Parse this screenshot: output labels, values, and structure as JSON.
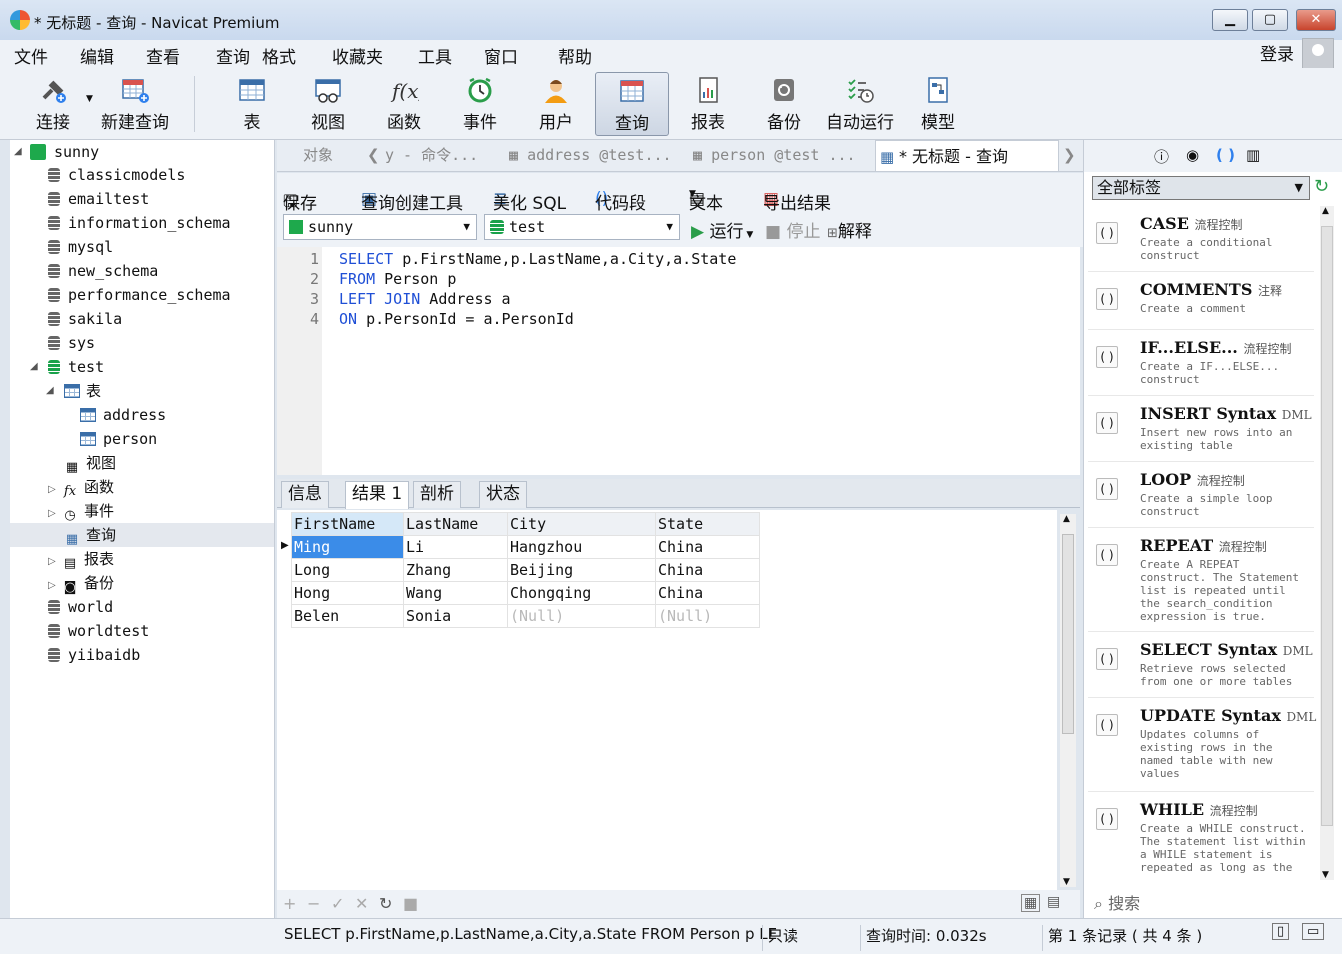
{
  "window": {
    "title": "* 无标题 - 查询 - Navicat Premium"
  },
  "menu": [
    "文件",
    "编辑",
    "查看",
    "查询",
    "格式",
    "收藏夹",
    "工具",
    "窗口",
    "帮助"
  ],
  "account": {
    "login": "登录"
  },
  "toolbar": [
    "连接",
    "新建查询",
    "表",
    "视图",
    "函数",
    "事件",
    "用户",
    "查询",
    "报表",
    "备份",
    "自动运行",
    "模型"
  ],
  "tree": [
    {
      "label": "sunny",
      "kind": "connection"
    },
    {
      "label": "classicmodels",
      "kind": "db"
    },
    {
      "label": "emailtest",
      "kind": "db"
    },
    {
      "label": "information_schema",
      "kind": "db"
    },
    {
      "label": "mysql",
      "kind": "db"
    },
    {
      "label": "new_schema",
      "kind": "db"
    },
    {
      "label": "performance_schema",
      "kind": "db"
    },
    {
      "label": "sakila",
      "kind": "db"
    },
    {
      "label": "sys",
      "kind": "db"
    },
    {
      "label": "test",
      "kind": "db-open"
    },
    {
      "label": "表",
      "kind": "folder"
    },
    {
      "label": "address",
      "kind": "table"
    },
    {
      "label": "person",
      "kind": "table"
    },
    {
      "label": "视图",
      "kind": "folder"
    },
    {
      "label": "函数",
      "kind": "folder"
    },
    {
      "label": "事件",
      "kind": "folder"
    },
    {
      "label": "查询",
      "kind": "folder"
    },
    {
      "label": "报表",
      "kind": "folder"
    },
    {
      "label": "备份",
      "kind": "folder"
    },
    {
      "label": "world",
      "kind": "db"
    },
    {
      "label": "worldtest",
      "kind": "db"
    },
    {
      "label": "yiibaidb",
      "kind": "db"
    }
  ],
  "tabs": [
    "对象",
    "y - 命令...",
    "address @test...",
    "person @test ...",
    "* 无标题 - 查询"
  ],
  "query_toolbar": [
    "保存",
    "查询创建工具",
    "美化 SQL",
    "代码段",
    "文本",
    "导出结果"
  ],
  "query_toolbar2": {
    "connection": "sunny",
    "database": "test",
    "run": "运行",
    "stop": "停止",
    "explain": "解释"
  },
  "editor": {
    "lines": [
      {
        "num": "1",
        "kw": "SELECT",
        "rest": " p.FirstName,p.LastName,a.City,a.State"
      },
      {
        "num": "2",
        "kw": "FROM",
        "rest": " Person p"
      },
      {
        "num": "3",
        "kw": "LEFT JOIN",
        "rest": " Address a"
      },
      {
        "num": "4",
        "kw": "ON",
        "rest": " p.PersonId = a.PersonId"
      }
    ]
  },
  "result_tabs": [
    "信息",
    "结果 1",
    "剖析",
    "状态"
  ],
  "grid": {
    "columns": [
      "FirstName",
      "LastName",
      "City",
      "State"
    ],
    "rows": [
      [
        "Ming",
        "Li",
        "Hangzhou",
        "China"
      ],
      [
        "Long",
        "Zhang",
        "Beijing",
        "China"
      ],
      [
        "Hong",
        "Wang",
        "Chongqing",
        "China"
      ],
      [
        "Belen",
        "Sonia",
        "(Null)",
        "(Null)"
      ]
    ]
  },
  "snippets": {
    "filter": "全部标签",
    "items": [
      {
        "name": "CASE",
        "tag": "流程控制",
        "desc": "Create a conditional construct"
      },
      {
        "name": "COMMENTS",
        "tag": "注释",
        "desc": "Create a comment"
      },
      {
        "name": "IF...ELSE...",
        "tag": "流程控制",
        "desc": "Create a IF...ELSE... construct"
      },
      {
        "name": "INSERT Syntax",
        "tag": "DML",
        "desc": "Insert new rows into an existing table"
      },
      {
        "name": "LOOP",
        "tag": "流程控制",
        "desc": "Create a simple loop construct"
      },
      {
        "name": "REPEAT",
        "tag": "流程控制",
        "desc": "Create A REPEAT construct. The Statement list is repeated until the search_condition expression is true."
      },
      {
        "name": "SELECT Syntax",
        "tag": "DML",
        "desc": "Retrieve rows selected from one or more tables"
      },
      {
        "name": "UPDATE Syntax",
        "tag": "DML",
        "desc": "Updates columns of existing rows in the named table with new values"
      },
      {
        "name": "WHILE",
        "tag": "流程控制",
        "desc": "Create a WHILE construct. The statement list within a WHILE statement is repeated as long as the"
      }
    ],
    "search": "搜索"
  },
  "status": {
    "sql": "SELECT p.FirstName,p.LastName,a.City,a.State  FROM Person p  LE",
    "mode": "只读",
    "time": "查询时间: 0.032s",
    "records": "第 1 条记录 ( 共 4 条 )"
  }
}
